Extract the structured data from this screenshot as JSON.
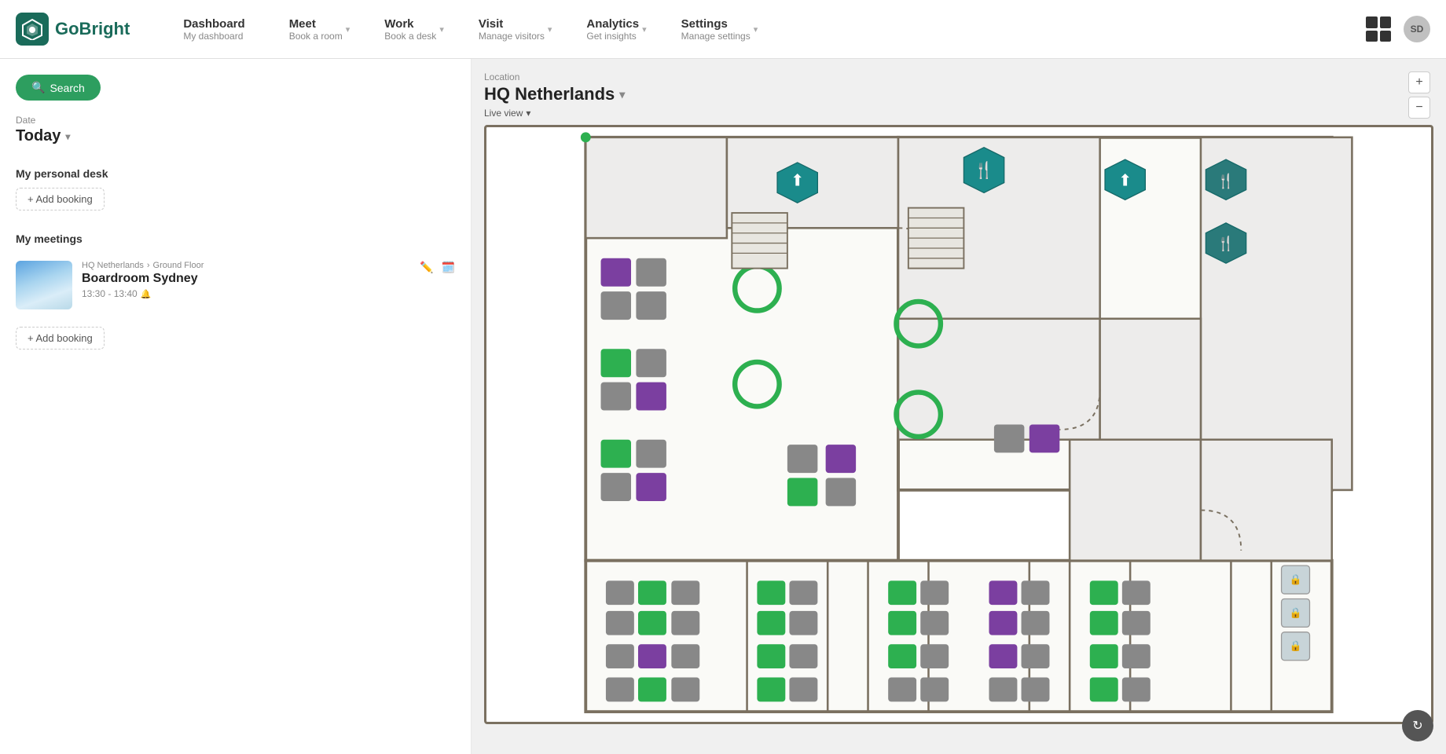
{
  "logo": {
    "text": "GoBright",
    "icon": "🔷"
  },
  "nav": {
    "items": [
      {
        "id": "dashboard",
        "title": "Dashboard",
        "sub": "My dashboard",
        "hasArrow": false
      },
      {
        "id": "meet",
        "title": "Meet",
        "sub": "Book a room",
        "hasArrow": true
      },
      {
        "id": "work",
        "title": "Work",
        "sub": "Book a desk",
        "hasArrow": true
      },
      {
        "id": "visit",
        "title": "Visit",
        "sub": "Manage visitors",
        "hasArrow": true
      },
      {
        "id": "analytics",
        "title": "Analytics",
        "sub": "Get insights",
        "hasArrow": true
      },
      {
        "id": "settings",
        "title": "Settings",
        "sub": "Manage settings",
        "hasArrow": true
      }
    ]
  },
  "header_right": {
    "user_initials": "SD"
  },
  "sidebar": {
    "search_label": "Search",
    "date_label": "Date",
    "date_value": "Today",
    "personal_desk_title": "My personal desk",
    "add_booking_label": "+ Add booking",
    "meetings_title": "My meetings",
    "meeting": {
      "breadcrumb_location": "HQ Netherlands",
      "breadcrumb_sep": "›",
      "breadcrumb_floor": "Ground Floor",
      "name": "Boardroom Sydney",
      "time": "13:30 - 13:40",
      "time_icon": "🔔"
    },
    "add_meeting_label": "+ Add booking"
  },
  "map": {
    "location_label": "Location",
    "location_name": "HQ Netherlands",
    "live_view_label": "Live view",
    "zoom_in": "+",
    "zoom_out": "−"
  },
  "colors": {
    "green": "#2db050",
    "purple": "#7b3fa0",
    "gray": "#888888",
    "teal": "#1a6b5a",
    "brand_green": "#2d9e5f"
  }
}
